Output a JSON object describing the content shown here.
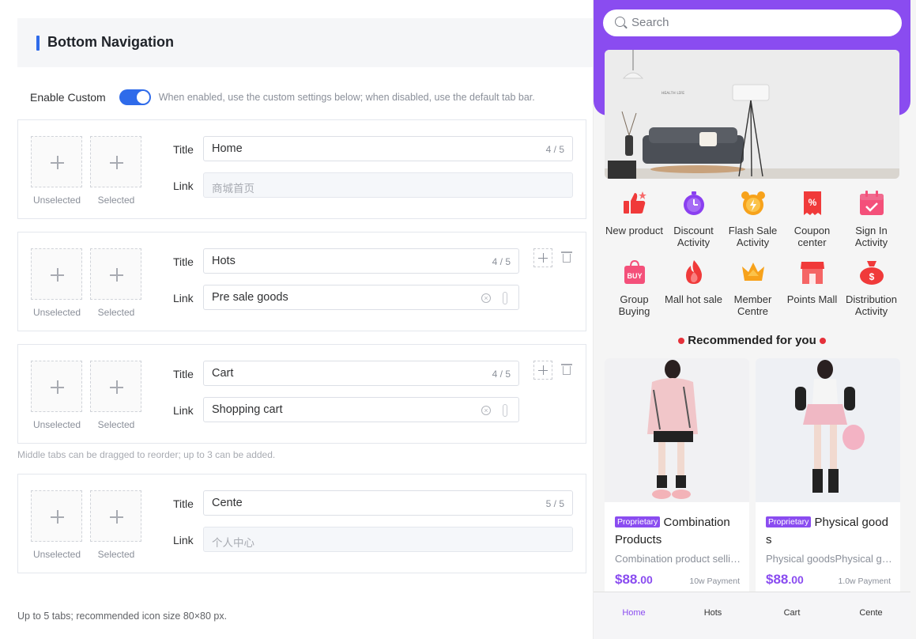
{
  "editor": {
    "section_title": "Bottom Navigation",
    "enable_label": "Enable Custom",
    "enable_hint": "When enabled, use the custom settings below; when disabled, use the default tab bar.",
    "enabled": true,
    "unselected_label": "Unselected",
    "selected_label": "Selected",
    "title_label": "Title",
    "link_label": "Link",
    "tabs": [
      {
        "title": "Home",
        "count": "4 / 5",
        "link": "商城首页",
        "link_editable": false
      },
      {
        "title": "Hots",
        "count": "4 / 5",
        "link": "Pre sale goods",
        "link_editable": true
      },
      {
        "title": "Cart",
        "count": "4 / 5",
        "link": "Shopping cart",
        "link_editable": true
      },
      {
        "title": "Cente",
        "count": "5 / 5",
        "link": "个人中心",
        "link_editable": false
      }
    ],
    "middle_note": "Middle tabs can be dragged to reorder; up to 3 can be added.",
    "bottom_note": "Up to 5 tabs; recommended icon size 80×80 px."
  },
  "preview": {
    "search_placeholder": "Search",
    "accent_color": "#8a4cf0",
    "banner_text": "ʜᴇᴀʟᴛʜ ʟɪғᴇ",
    "grid": [
      {
        "label": "New product",
        "icon": "thumbs-up-icon",
        "color": "#f03a3a"
      },
      {
        "label": "Discount Activity",
        "icon": "stopwatch-icon",
        "color": "#8a3ff0"
      },
      {
        "label": "Flash Sale Activity",
        "icon": "alarm-clock-icon",
        "color": "#f7a21b"
      },
      {
        "label": "Coupon center",
        "icon": "coupon-icon",
        "color": "#f03a3a"
      },
      {
        "label": "Sign In Activity",
        "icon": "calendar-check-icon",
        "color": "#f4507a"
      },
      {
        "label": "Group Buying",
        "icon": "shopping-bag-icon",
        "color": "#f4507a"
      },
      {
        "label": "Mall hot sale",
        "icon": "flame-icon",
        "color": "#f03a3a"
      },
      {
        "label": "Member Centre",
        "icon": "crown-icon",
        "color": "#f7a21b"
      },
      {
        "label": "Points Mall",
        "icon": "storefront-icon",
        "color": "#f03a3a"
      },
      {
        "label": "Distribution Activity",
        "icon": "money-bag-icon",
        "color": "#f03a3a"
      }
    ],
    "recommend_title": "Recommended for you",
    "products": [
      {
        "badge": "Proprietary",
        "title": "Combination Products",
        "desc": "Combination product selli…",
        "price_int": "$88",
        "price_dec": ".00",
        "sold": "10w Payment"
      },
      {
        "badge": "Proprietary",
        "title": "Physical good s",
        "desc": "Physical goodsPhysical g…",
        "price_int": "$88",
        "price_dec": ".00",
        "sold": "1.0w Payment"
      }
    ],
    "tabbar": [
      "Home",
      "Hots",
      "Cart",
      "Cente"
    ],
    "active_tab": 0
  }
}
